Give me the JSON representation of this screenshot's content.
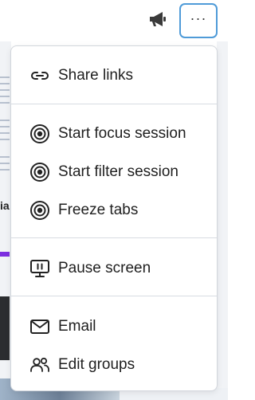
{
  "topbar": {
    "announcement_icon": "megaphone-icon",
    "more_button": {
      "icon": "more-horizontal-icon",
      "label": "···"
    }
  },
  "background": {
    "partial_heading": "ia"
  },
  "menu": {
    "groups": [
      {
        "items": [
          {
            "label": "Share links",
            "icon": "link-icon"
          }
        ]
      },
      {
        "items": [
          {
            "label": "Start focus session",
            "icon": "target-icon"
          },
          {
            "label": "Start filter session",
            "icon": "target-icon"
          },
          {
            "label": "Freeze tabs",
            "icon": "target-icon"
          }
        ]
      },
      {
        "items": [
          {
            "label": "Pause screen",
            "icon": "monitor-pause-icon"
          }
        ]
      },
      {
        "items": [
          {
            "label": "Email",
            "icon": "mail-icon"
          },
          {
            "label": "Edit groups",
            "icon": "users-icon"
          }
        ]
      }
    ]
  },
  "colors": {
    "accent_border": "#4f9bd8",
    "text": "#1f1f1f",
    "divider": "#d8dce2"
  }
}
